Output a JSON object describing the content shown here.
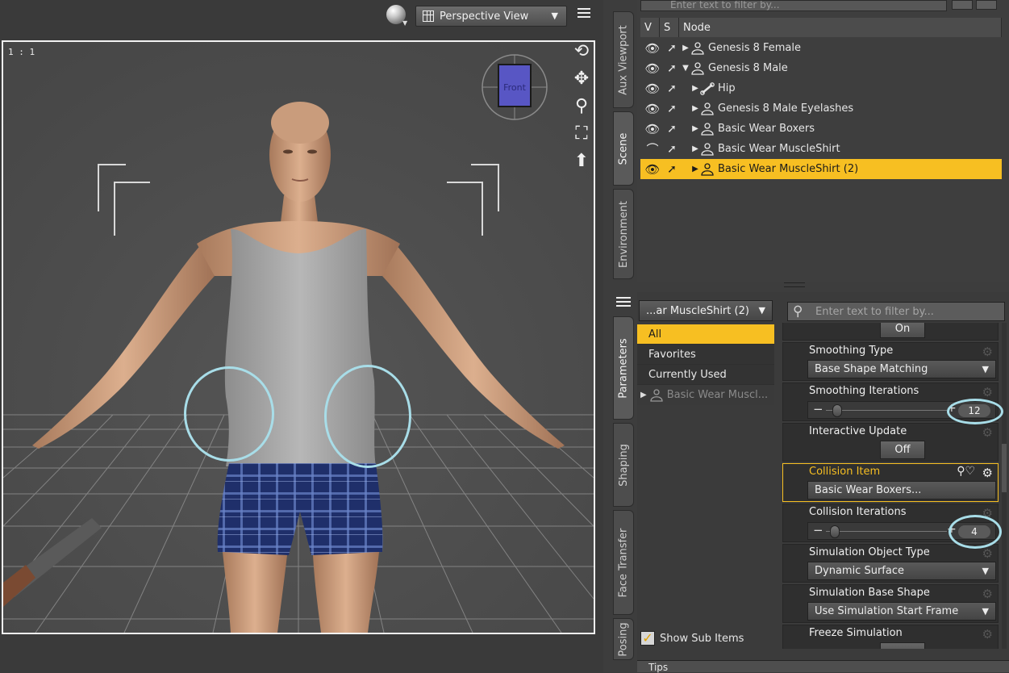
{
  "viewport": {
    "view_select": "Perspective View",
    "zoom_label": "1 : 1",
    "camera_cube_label": "Front"
  },
  "side_tabs_top": [
    "Aux Viewport",
    "Scene",
    "Environment"
  ],
  "side_tabs_bottom": [
    "Parameters",
    "Shaping",
    "Face Transfer",
    "Posing"
  ],
  "scene": {
    "filter_placeholder": "Enter text to filter by...",
    "headers": {
      "v": "V",
      "s": "S",
      "node": "Node"
    },
    "nodes": [
      {
        "label": "Genesis 8 Female",
        "indent": 0,
        "expanded": false,
        "selected": false,
        "icon": "figure-icon",
        "visible": true
      },
      {
        "label": "Genesis 8 Male",
        "indent": 0,
        "expanded": true,
        "selected": false,
        "icon": "figure-icon",
        "visible": true
      },
      {
        "label": "Hip",
        "indent": 1,
        "expanded": false,
        "selected": false,
        "icon": "bone-icon",
        "visible": true
      },
      {
        "label": "Genesis 8 Male Eyelashes",
        "indent": 1,
        "expanded": false,
        "selected": false,
        "icon": "figure-icon",
        "visible": true
      },
      {
        "label": "Basic Wear Boxers",
        "indent": 1,
        "expanded": false,
        "selected": false,
        "icon": "figure-icon",
        "visible": true
      },
      {
        "label": "Basic Wear MuscleShirt",
        "indent": 1,
        "expanded": false,
        "selected": false,
        "icon": "figure-icon",
        "visible": false
      },
      {
        "label": "Basic Wear MuscleShirt (2)",
        "indent": 1,
        "expanded": false,
        "selected": true,
        "icon": "figure-icon",
        "visible": true
      }
    ]
  },
  "parameters": {
    "node_select": "...ar MuscleShirt (2)",
    "filter_placeholder": "Enter text to filter by...",
    "categories": [
      {
        "label": "All",
        "selected": true
      },
      {
        "label": "Favorites",
        "selected": false
      },
      {
        "label": "Currently Used",
        "selected": false
      }
    ],
    "sub_item": "Basic Wear Muscl...",
    "show_sub_items": "Show Sub Items",
    "top_toggle": "On",
    "params": [
      {
        "name": "Smoothing Type",
        "kind": "dropdown",
        "value": "Base Shape Matching"
      },
      {
        "name": "Smoothing Iterations",
        "kind": "slider",
        "value": "12",
        "fraction": 0.05
      },
      {
        "name": "Interactive Update",
        "kind": "toggle",
        "value": "Off"
      },
      {
        "name": "Collision Item",
        "kind": "button",
        "value": "Basic Wear Boxers...",
        "highlight": true
      },
      {
        "name": "Collision Iterations",
        "kind": "slider",
        "value": "4",
        "fraction": 0.03
      },
      {
        "name": "Simulation Object Type",
        "kind": "dropdown",
        "value": "Dynamic Surface"
      },
      {
        "name": "Simulation Base Shape",
        "kind": "dropdown",
        "value": "Use Simulation Start Frame"
      },
      {
        "name": "Freeze Simulation",
        "kind": "toggle",
        "value": ""
      }
    ]
  },
  "tips_label": "Tips",
  "colors": {
    "accent": "#f7bf22",
    "annotation": "#a8dde8"
  }
}
